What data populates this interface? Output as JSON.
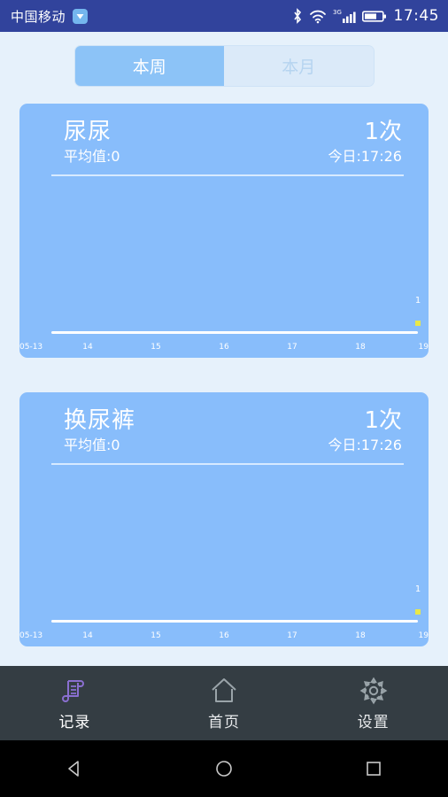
{
  "status_bar": {
    "carrier": "中国移动",
    "carrier_badge_icon": "app-badge-icon",
    "bluetooth_icon": "bluetooth-icon",
    "wifi_icon": "wifi-icon",
    "network_type": "3G",
    "signal_icon": "signal-bars-icon",
    "battery_icon": "battery-icon",
    "time": "17:45",
    "background_color": "#31439c"
  },
  "segmented_control": {
    "options": [
      {
        "label": "本周",
        "active": true
      },
      {
        "label": "本月",
        "active": false
      }
    ],
    "active_color": "#8cc3f7",
    "inactive_color": "#dbeaf9"
  },
  "cards": [
    {
      "title": "尿尿",
      "average_label": "平均值:0",
      "count": "1次",
      "today_label": "今日:17:26"
    },
    {
      "title": "换尿裤",
      "average_label": "平均值:0",
      "count": "1次",
      "today_label": "今日:17:26"
    }
  ],
  "chart_data": [
    {
      "type": "line",
      "title": "尿尿",
      "categories": [
        "05-13",
        "14",
        "15",
        "16",
        "17",
        "18",
        "19"
      ],
      "values": [
        0,
        0,
        0,
        0,
        0,
        0,
        1
      ],
      "point_labels": [
        "",
        "",
        "",
        "",
        "",
        "",
        "1"
      ],
      "xlabel": "",
      "ylabel": "",
      "ylim": [
        0,
        1
      ],
      "grid": false,
      "legend": "none",
      "point_color": "#e8e84a",
      "axis_color": "#ffffff"
    },
    {
      "type": "line",
      "title": "换尿裤",
      "categories": [
        "05-13",
        "14",
        "15",
        "16",
        "17",
        "18",
        "19"
      ],
      "values": [
        0,
        0,
        0,
        0,
        0,
        0,
        1
      ],
      "point_labels": [
        "",
        "",
        "",
        "",
        "",
        "",
        "1"
      ],
      "xlabel": "",
      "ylabel": "",
      "ylim": [
        0,
        1
      ],
      "grid": false,
      "legend": "none",
      "point_color": "#e8e84a",
      "axis_color": "#ffffff"
    }
  ],
  "bottom_nav": {
    "items": [
      {
        "label": "记录",
        "icon": "scroll-record-icon",
        "active": true
      },
      {
        "label": "首页",
        "icon": "home-icon",
        "active": false
      },
      {
        "label": "设置",
        "icon": "gear-icon",
        "active": false
      }
    ],
    "active_icon_color": "#8a6fd0",
    "background_color": "#343d43"
  },
  "android_nav": {
    "back_icon": "back-triangle-icon",
    "home_icon": "home-circle-icon",
    "recents_icon": "recents-square-icon"
  },
  "theme": {
    "page_background": "#e6f1fb",
    "card_background": "#88bdfb"
  }
}
